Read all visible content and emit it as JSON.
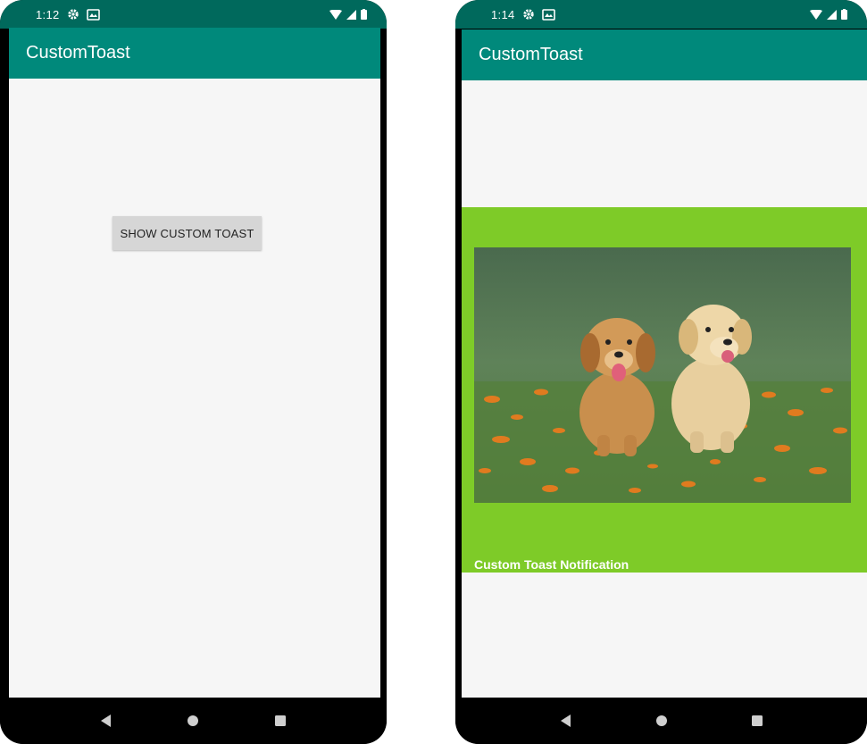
{
  "colors": {
    "primary": "#00897b",
    "primary_dark": "#00695c",
    "toast_background": "#7ecb28",
    "button_background": "#d6d6d6"
  },
  "screens": [
    {
      "status_time": "1:12",
      "app_title": "CustomToast",
      "button_label": "SHOW CUSTOM TOAST"
    },
    {
      "status_time": "1:14",
      "app_title": "CustomToast",
      "toast": {
        "image": "puppies-photo",
        "text": "Custom Toast Notification"
      }
    }
  ],
  "status_icons": [
    "settings-icon",
    "message-icon",
    "wifi-icon",
    "signal-icon",
    "battery-icon"
  ],
  "nav_icons": [
    "back-icon",
    "home-icon",
    "recents-icon"
  ]
}
